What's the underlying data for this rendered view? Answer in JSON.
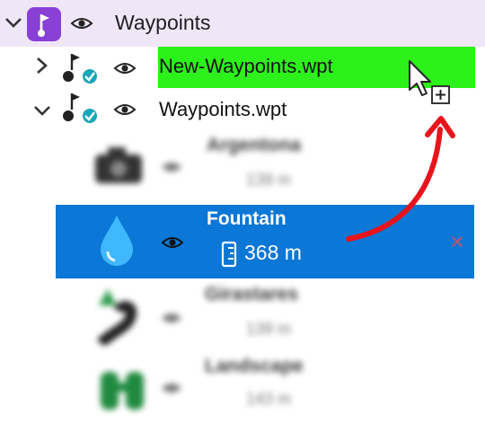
{
  "tree": {
    "root": {
      "label": "Waypoints",
      "icon": "flag-icon",
      "expanded": true
    },
    "files": [
      {
        "label": "New-Waypoints.wpt",
        "expanded": false,
        "highlighted": true
      },
      {
        "label": "Waypoints.wpt",
        "expanded": true,
        "highlighted": false
      }
    ],
    "waypoints": [
      {
        "name": "Argentona",
        "distance": "139 m",
        "icon": "camera-icon",
        "blurred": true
      },
      {
        "name": "Fountain",
        "distance": "368 m",
        "icon": "water-drop-icon",
        "selected": true
      },
      {
        "name": "Girastares",
        "distance": "139 m",
        "icon": "road-icon",
        "blurred": true
      },
      {
        "name": "Landscape",
        "distance": "143 m",
        "icon": "binoculars-icon",
        "blurred": true
      }
    ]
  },
  "drag": {
    "cursor_icon": "copy-cursor-icon",
    "arrow_color": "#e8141b"
  },
  "colors": {
    "root_bg": "#efe7f8",
    "accent_purple": "#8a3fd7",
    "drop_target": "#2df11a",
    "selection": "#0b77d6",
    "check_teal": "#19a6b8"
  }
}
